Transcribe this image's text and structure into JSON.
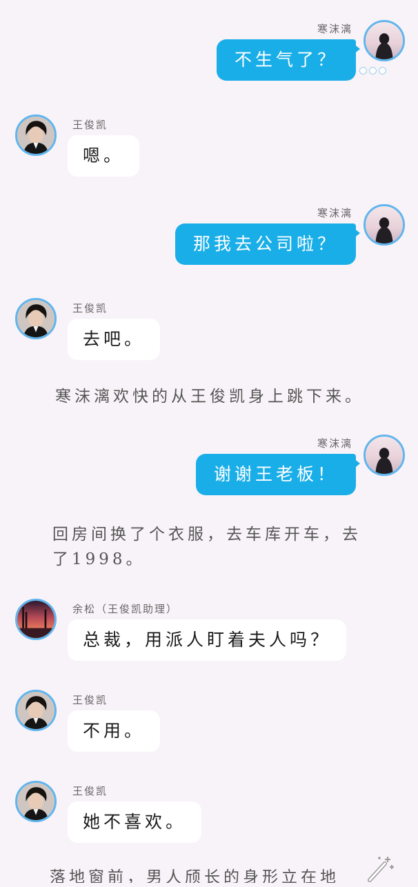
{
  "messages": [
    {
      "side": "right",
      "name": "寒沫漓",
      "text": "不生气了？",
      "avatar": "girl-avatar"
    },
    {
      "side": "left",
      "name": "王俊凯",
      "text": "嗯。",
      "avatar": "boy-avatar"
    },
    {
      "side": "right",
      "name": "寒沫漓",
      "text": "那我去公司啦？",
      "avatar": "girl-avatar"
    },
    {
      "side": "left",
      "name": "王俊凯",
      "text": "去吧。",
      "avatar": "boy-avatar"
    },
    {
      "narration": "寒沫漓欢快的从王俊凯身上跳下来。"
    },
    {
      "side": "right",
      "name": "寒沫漓",
      "text": "谢谢王老板！",
      "avatar": "girl-avatar"
    },
    {
      "narration": "回房间换了个衣服，去车库开车，去了1998。"
    },
    {
      "side": "left",
      "name": "余松（王俊凯助理）",
      "text": "总裁，用派人盯着夫人吗？",
      "avatar": "sunset-avatar"
    },
    {
      "side": "left",
      "name": "王俊凯",
      "text": "不用。",
      "avatar": "boy-avatar"
    },
    {
      "side": "left",
      "name": "王俊凯",
      "text": "她不喜欢。",
      "avatar": "boy-avatar"
    },
    {
      "narration": "落地窗前，男人颀长的身形立在地"
    }
  ],
  "colors": {
    "background": "#f8f3f8",
    "sent_bubble": "#1aaee8",
    "received_bubble": "#ffffff",
    "avatar_ring": "#5fb5ee"
  },
  "icons": {
    "wand": "magic-wand-icon",
    "typing": "typing-dots-icon"
  }
}
